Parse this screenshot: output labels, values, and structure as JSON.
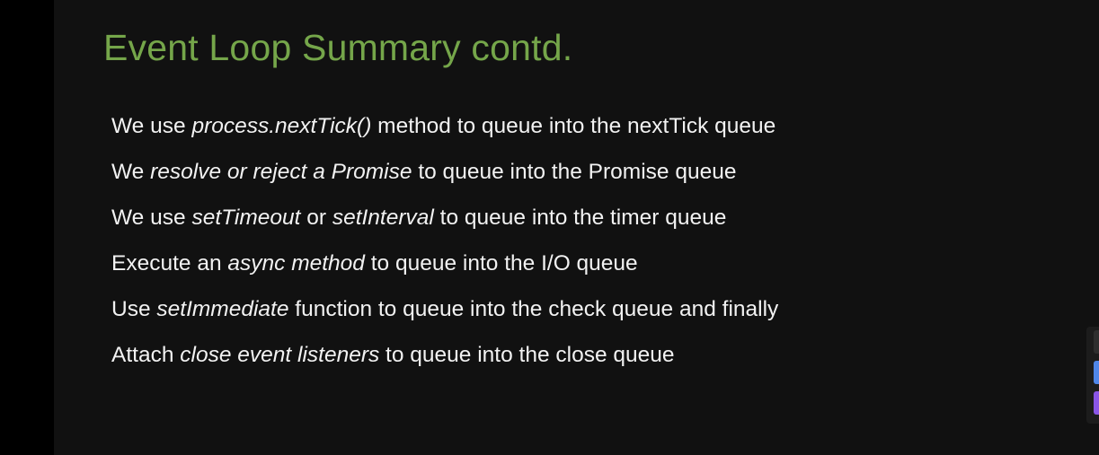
{
  "slide": {
    "title": "Event Loop Summary contd.",
    "bullets": [
      {
        "parts": [
          {
            "text": "We use ",
            "italic": false
          },
          {
            "text": "process.nextTick()",
            "italic": true
          },
          {
            "text": " method to queue into the nextTick queue",
            "italic": false
          }
        ]
      },
      {
        "parts": [
          {
            "text": "We ",
            "italic": false
          },
          {
            "text": "resolve or reject a Promise",
            "italic": true
          },
          {
            "text": " to queue into the Promise queue",
            "italic": false
          }
        ]
      },
      {
        "parts": [
          {
            "text": "We use ",
            "italic": false
          },
          {
            "text": "setTimeout",
            "italic": true
          },
          {
            "text": " or ",
            "italic": false
          },
          {
            "text": "setInterval",
            "italic": true
          },
          {
            "text": " to queue into the timer queue",
            "italic": false
          }
        ]
      },
      {
        "parts": [
          {
            "text": "Execute an ",
            "italic": false
          },
          {
            "text": "async method",
            "italic": true
          },
          {
            "text": " to queue into the I/O queue",
            "italic": false
          }
        ]
      },
      {
        "parts": [
          {
            "text": "Use ",
            "italic": false
          },
          {
            "text": "setImmediate",
            "italic": true
          },
          {
            "text": " function to queue into the check queue and finally",
            "italic": false
          }
        ]
      },
      {
        "parts": [
          {
            "text": "Attach ",
            "italic": false
          },
          {
            "text": "close event listeners",
            "italic": true
          },
          {
            "text": " to queue into the close queue",
            "italic": false
          }
        ]
      }
    ]
  },
  "colors": {
    "title": "#75a64a",
    "text": "#f2f2f2",
    "slide_background": "#111111",
    "page_background": "#000000"
  },
  "side_widget": {
    "buttons": [
      "toolbar-button",
      "blue-action-button",
      "purple-action-button"
    ]
  }
}
